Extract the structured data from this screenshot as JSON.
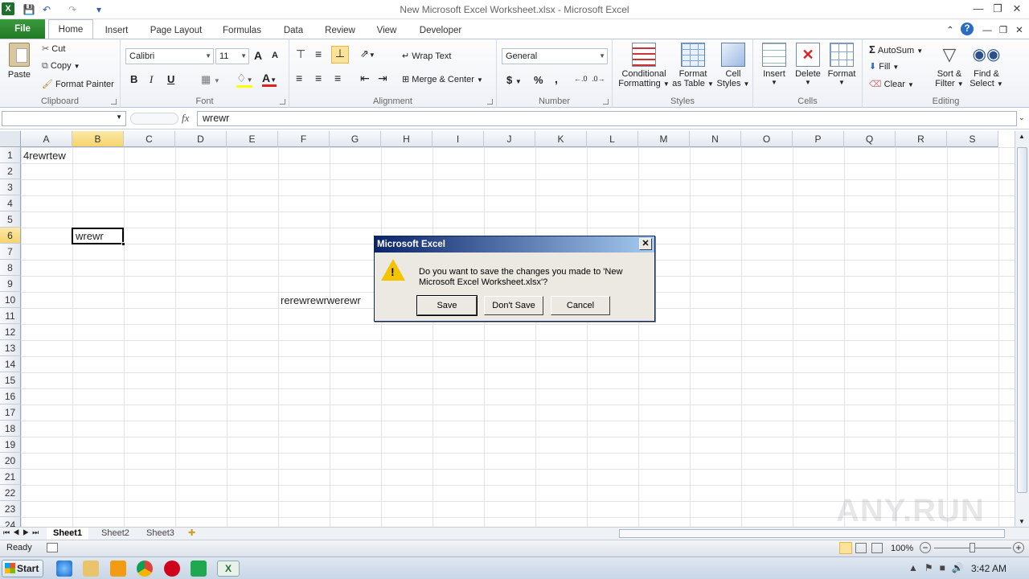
{
  "window": {
    "title": "New Microsoft Excel Worksheet.xlsx  -  Microsoft Excel",
    "qa_customize": "▾"
  },
  "tabs": [
    "File",
    "Home",
    "Insert",
    "Page Layout",
    "Formulas",
    "Data",
    "Review",
    "View",
    "Developer"
  ],
  "ribbon": {
    "clipboard": {
      "label": "Clipboard",
      "paste": "Paste",
      "cut": "Cut",
      "copy": "Copy",
      "format_painter": "Format Painter"
    },
    "font": {
      "label": "Font",
      "name": "Calibri",
      "size": "11",
      "bold": "B",
      "italic": "I",
      "underline": "U",
      "grow": "A",
      "shrink": "A"
    },
    "alignment": {
      "label": "Alignment",
      "wrap": "Wrap Text",
      "merge": "Merge & Center"
    },
    "number": {
      "label": "Number",
      "format": "General",
      "currency": "$",
      "percent": "%",
      "comma": ",",
      "inc_dec": "←.0 .00",
      "dec_dec": ".00 →.0"
    },
    "styles": {
      "label": "Styles",
      "conditional": "Conditional",
      "conditional2": "Formatting",
      "format_table": "Format",
      "format_table2": "as Table",
      "cell_styles": "Cell",
      "cell_styles2": "Styles"
    },
    "cells": {
      "label": "Cells",
      "insert": "Insert",
      "delete": "Delete",
      "format": "Format"
    },
    "editing": {
      "label": "Editing",
      "autosum": "AutoSum",
      "fill": "Fill",
      "clear": "Clear",
      "sort": "Sort &",
      "sort2": "Filter",
      "find": "Find &",
      "find2": "Select"
    }
  },
  "formula_bar": {
    "fx": "fx",
    "value": "wrewr"
  },
  "columns": [
    "A",
    "B",
    "C",
    "D",
    "E",
    "F",
    "G",
    "H",
    "I",
    "J",
    "K",
    "L",
    "M",
    "N",
    "O",
    "P",
    "Q",
    "R",
    "S"
  ],
  "rows": [
    "1",
    "2",
    "3",
    "4",
    "5",
    "6",
    "7",
    "8",
    "9",
    "10",
    "11",
    "12",
    "13",
    "14",
    "15",
    "16",
    "17",
    "18",
    "19",
    "20",
    "21",
    "22",
    "23",
    "24"
  ],
  "cells": {
    "A1": "4rewrtew",
    "B6": "wrewr",
    "F10": "rerewrewrwerewr"
  },
  "sheets": [
    "Sheet1",
    "Sheet2",
    "Sheet3"
  ],
  "status": {
    "ready": "Ready",
    "zoom": "100%"
  },
  "dialog": {
    "title": "Microsoft Excel",
    "message": "Do you want to save the changes you made to 'New Microsoft Excel Worksheet.xlsx'?",
    "save": "Save",
    "dont_save": "Don't Save",
    "cancel": "Cancel"
  },
  "taskbar": {
    "start": "Start",
    "time": "3:42 AM"
  },
  "watermark": "ANY.RUN",
  "colors": {
    "file_tab": "#217a26",
    "selection": "#f6d46b",
    "dialog_title": "#0a246a"
  }
}
